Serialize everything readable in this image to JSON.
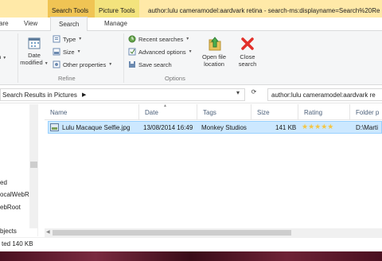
{
  "title": {
    "search_tools": "Search Tools",
    "picture_tools": "Picture Tools",
    "window_title": "author:lulu cameramodel:aardvark retina - search-ms:displayname=Search%20Re"
  },
  "tabs": [
    "are",
    "View",
    "Search",
    "Manage"
  ],
  "ribbon": {
    "date_modified": [
      "Date",
      "modified"
    ],
    "type": "Type",
    "size": "Size",
    "other_properties": "Other properties",
    "refine_label": "Refine",
    "recent_searches": "Recent searches",
    "advanced_options": "Advanced options",
    "save_search": "Save search",
    "open_file_location": [
      "Open file",
      "location"
    ],
    "close_search": [
      "Close",
      "search"
    ],
    "options_label": "Options"
  },
  "address": {
    "path": "Search Results in Pictures",
    "search_query": "author:lulu cameramodel:aardvark re"
  },
  "nav": {
    "items": [
      "ed",
      "ocalWebRe",
      "ebRoot",
      "bjects"
    ]
  },
  "columns": [
    "Name",
    "Date",
    "Tags",
    "Size",
    "Rating",
    "Folder p"
  ],
  "files": [
    {
      "name": "Lulu Macaque Selfie.jpg",
      "date": "13/08/2014 16:49",
      "tags": "Monkey Studios",
      "size": "141 KB",
      "rating": 5,
      "folder": "D:\\Marti"
    }
  ],
  "status": {
    "text": "ted  140 KB"
  },
  "colors": {
    "search_tools_tab": "#f0c454",
    "picture_tools_tab": "#f3e37d",
    "selection": "#cce8ff",
    "header_text": "#4c607a",
    "close_icon": "#e2302a"
  }
}
